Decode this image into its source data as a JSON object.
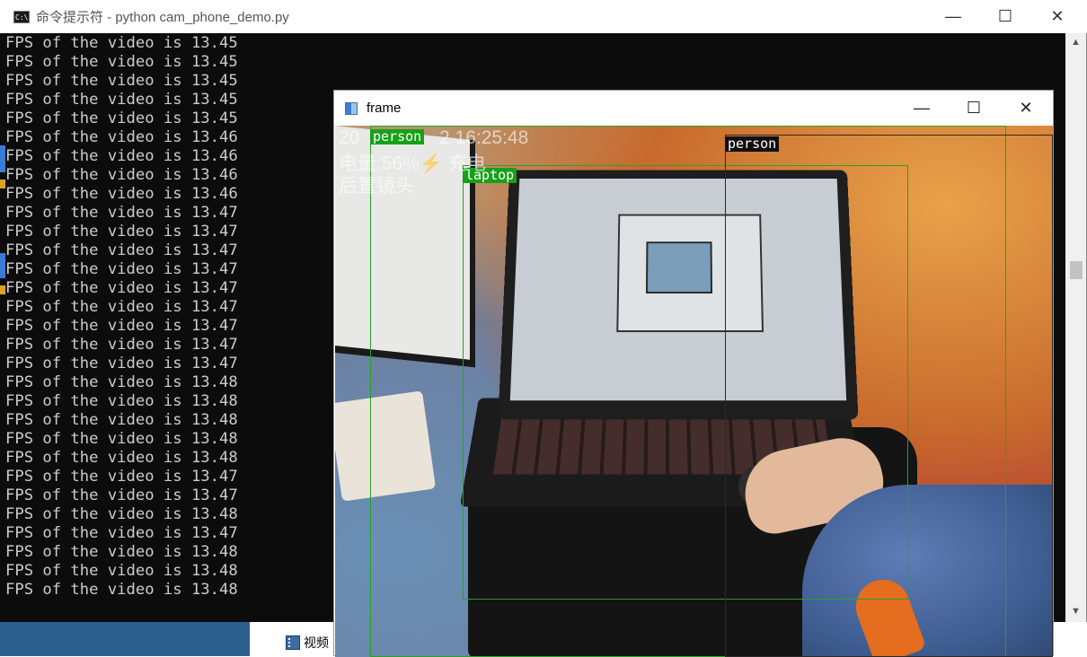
{
  "console": {
    "title": "命令提示符 - python  cam_phone_demo.py",
    "icon_text": "C:\\",
    "output": [
      "FPS of the video is 13.45",
      "FPS of the video is 13.45",
      "FPS of the video is 13.45",
      "FPS of the video is 13.45",
      "FPS of the video is 13.45",
      "FPS of the video is 13.46",
      "FPS of the video is 13.46",
      "FPS of the video is 13.46",
      "FPS of the video is 13.46",
      "FPS of the video is 13.47",
      "FPS of the video is 13.47",
      "FPS of the video is 13.47",
      "FPS of the video is 13.47",
      "FPS of the video is 13.47",
      "FPS of the video is 13.47",
      "FPS of the video is 13.47",
      "FPS of the video is 13.47",
      "FPS of the video is 13.47",
      "FPS of the video is 13.48",
      "FPS of the video is 13.48",
      "FPS of the video is 13.48",
      "FPS of the video is 13.48",
      "FPS of the video is 13.48",
      "FPS of the video is 13.47",
      "FPS of the video is 13.47",
      "FPS of the video is 13.48",
      "FPS of the video is 13.47",
      "FPS of the video is 13.48",
      "FPS of the video is 13.48",
      "FPS of the video is 13.48"
    ],
    "controls": {
      "minimize": "—",
      "maximize": "☐",
      "close": "✕"
    },
    "scroll_up": "▲",
    "scroll_down": "▼"
  },
  "frame_window": {
    "title": "frame",
    "controls": {
      "minimize": "—",
      "maximize": "☐",
      "close": "✕"
    },
    "overlay": {
      "line1": "20",
      "line1_time": "2 16:25:48",
      "line2": "电量:56%⚡ 充电",
      "line3": "后置镜头"
    },
    "detections": [
      {
        "label": "person",
        "style": "green"
      },
      {
        "label": "laptop",
        "style": "green"
      },
      {
        "label": "person",
        "style": "black"
      }
    ]
  },
  "explorer": {
    "item_label": "视频"
  }
}
